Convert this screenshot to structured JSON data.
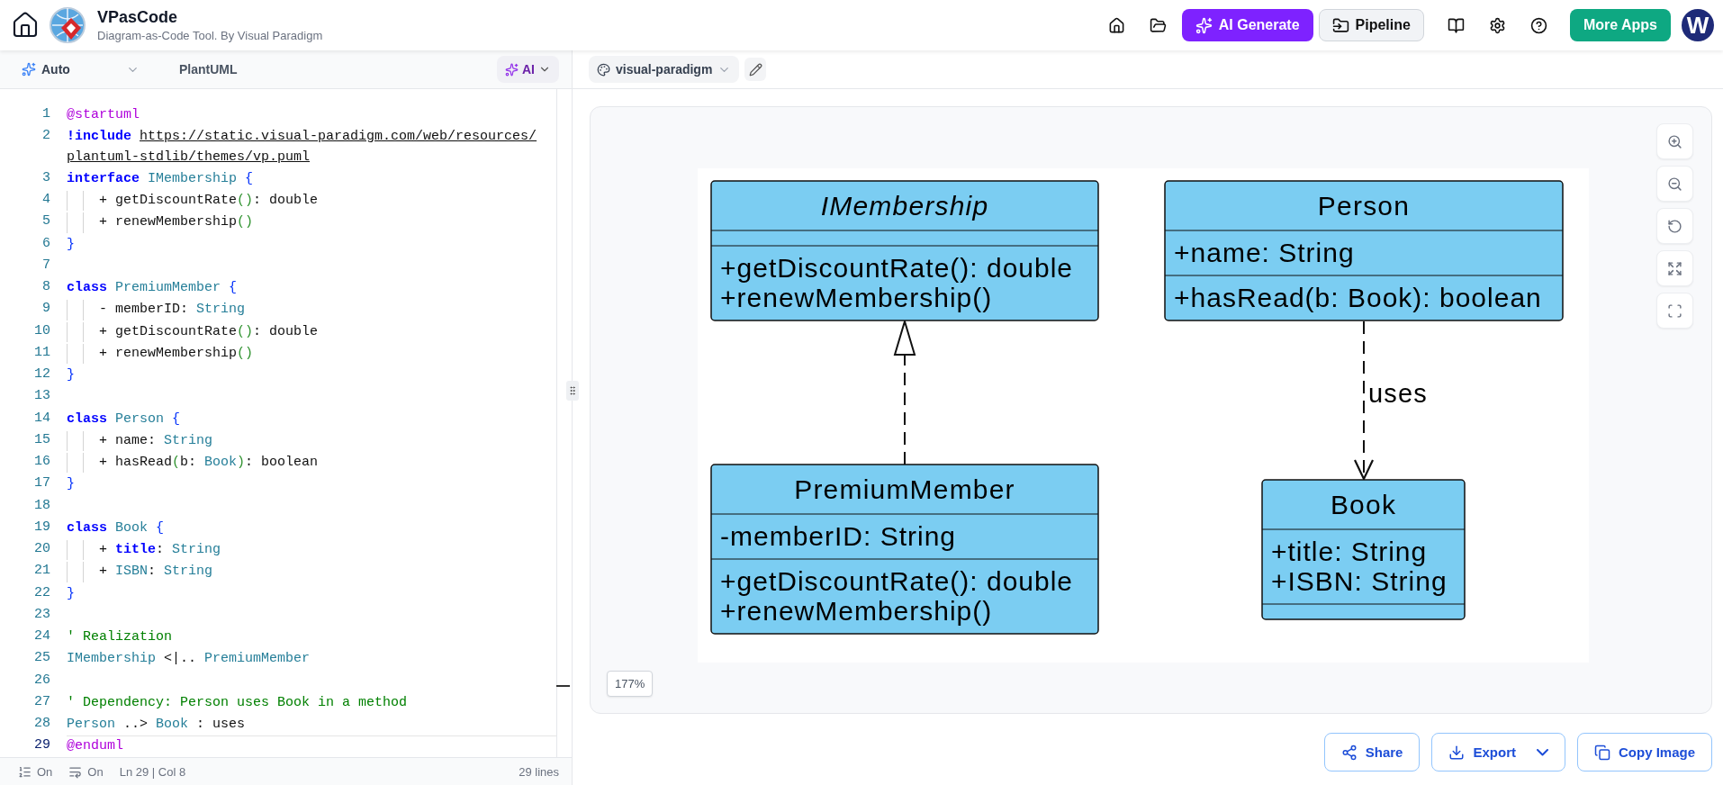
{
  "header": {
    "title": "VPasCode",
    "subtitle": "Diagram-as-Code Tool. By Visual Paradigm",
    "buttons": [
      {
        "kind": "ai",
        "label": "AI Generate"
      },
      {
        "kind": "pipeline",
        "label": "Pipeline"
      },
      {
        "kind": "apps",
        "label": "More Apps"
      }
    ],
    "avatar": "W"
  },
  "editor_toolbar": {
    "mode": "Auto",
    "language": "PlantUML",
    "ai": "AI"
  },
  "editor": {
    "lines": [
      {
        "n": "1",
        "indented": false,
        "current": false,
        "tokens": [
          {
            "kind": "directive",
            "text": "@startuml"
          }
        ]
      },
      {
        "n": "2",
        "indented": false,
        "current": false,
        "tokens": [
          {
            "kind": "keyword",
            "text": "!include "
          },
          {
            "kind": "link",
            "text": "https://static.visual-paradigm.com/web/resources/"
          },
          {
            "kind": "link",
            "text": "plantuml-stdlib/themes/vp.puml"
          }
        ]
      },
      {
        "n": "3",
        "indented": false,
        "current": false,
        "tokens": [
          {
            "kind": "keyword",
            "text": "interface "
          },
          {
            "kind": "type",
            "text": "IMembership "
          },
          {
            "kind": "brace",
            "text": "{"
          }
        ]
      },
      {
        "n": "4",
        "indented": true,
        "current": false,
        "tokens": [
          {
            "kind": "plain",
            "text": "+ getDiscountRate"
          },
          {
            "kind": "paren",
            "text": "()"
          },
          {
            "kind": "plain",
            "text": ": double"
          }
        ]
      },
      {
        "n": "5",
        "indented": true,
        "current": false,
        "tokens": [
          {
            "kind": "plain",
            "text": "+ renewMembership"
          },
          {
            "kind": "paren",
            "text": "()"
          }
        ]
      },
      {
        "n": "6",
        "indented": false,
        "current": false,
        "tokens": [
          {
            "kind": "brace",
            "text": "}"
          }
        ]
      },
      {
        "n": "7",
        "current": false
      },
      {
        "n": "8",
        "indented": false,
        "current": false,
        "tokens": [
          {
            "kind": "keyword",
            "text": "class "
          },
          {
            "kind": "type",
            "text": "PremiumMember "
          },
          {
            "kind": "brace",
            "text": "{"
          }
        ]
      },
      {
        "n": "9",
        "indented": true,
        "current": false,
        "tokens": [
          {
            "kind": "plain",
            "text": "- memberID: "
          },
          {
            "kind": "type",
            "text": "String"
          }
        ]
      },
      {
        "n": "10",
        "indented": true,
        "current": false,
        "tokens": [
          {
            "kind": "plain",
            "text": "+ getDiscountRate"
          },
          {
            "kind": "paren",
            "text": "()"
          },
          {
            "kind": "plain",
            "text": ": double"
          }
        ]
      },
      {
        "n": "11",
        "indented": true,
        "current": false,
        "tokens": [
          {
            "kind": "plain",
            "text": "+ renewMembership"
          },
          {
            "kind": "paren",
            "text": "()"
          }
        ]
      },
      {
        "n": "12",
        "indented": false,
        "current": false,
        "tokens": [
          {
            "kind": "brace",
            "text": "}"
          }
        ]
      },
      {
        "n": "13",
        "current": false
      },
      {
        "n": "14",
        "indented": false,
        "current": false,
        "tokens": [
          {
            "kind": "keyword",
            "text": "class "
          },
          {
            "kind": "type",
            "text": "Person "
          },
          {
            "kind": "brace",
            "text": "{"
          }
        ]
      },
      {
        "n": "15",
        "indented": true,
        "current": false,
        "tokens": [
          {
            "kind": "plain",
            "text": "+ name: "
          },
          {
            "kind": "type",
            "text": "String"
          }
        ]
      },
      {
        "n": "16",
        "indented": true,
        "current": false,
        "tokens": [
          {
            "kind": "plain",
            "text": "+ hasRead"
          },
          {
            "kind": "paren",
            "text": "("
          },
          {
            "kind": "plain",
            "text": "b: "
          },
          {
            "kind": "type",
            "text": "Book"
          },
          {
            "kind": "paren",
            "text": ")"
          },
          {
            "kind": "plain",
            "text": ": boolean"
          }
        ]
      },
      {
        "n": "17",
        "indented": false,
        "current": false,
        "tokens": [
          {
            "kind": "brace",
            "text": "}"
          }
        ]
      },
      {
        "n": "18",
        "current": false
      },
      {
        "n": "19",
        "indented": false,
        "current": false,
        "tokens": [
          {
            "kind": "keyword",
            "text": "class "
          },
          {
            "kind": "type",
            "text": "Book "
          },
          {
            "kind": "brace",
            "text": "{"
          }
        ]
      },
      {
        "n": "20",
        "indented": true,
        "current": false,
        "tokens": [
          {
            "kind": "plain",
            "text": "+ "
          },
          {
            "kind": "keyword",
            "text": "title"
          },
          {
            "kind": "plain",
            "text": ": "
          },
          {
            "kind": "type",
            "text": "String"
          }
        ]
      },
      {
        "n": "21",
        "indented": true,
        "current": false,
        "tokens": [
          {
            "kind": "plain",
            "text": "+ "
          },
          {
            "kind": "type",
            "text": "ISBN"
          },
          {
            "kind": "plain",
            "text": ": "
          },
          {
            "kind": "type",
            "text": "String"
          }
        ]
      },
      {
        "n": "22",
        "indented": false,
        "current": false,
        "tokens": [
          {
            "kind": "brace",
            "text": "}"
          }
        ]
      },
      {
        "n": "23",
        "current": false
      },
      {
        "n": "24",
        "indented": false,
        "current": false,
        "tokens": [
          {
            "kind": "comment",
            "text": "' Realization"
          }
        ]
      },
      {
        "n": "25",
        "indented": false,
        "current": false,
        "tokens": [
          {
            "kind": "type",
            "text": "IMembership "
          },
          {
            "kind": "plain",
            "text": "<|.. "
          },
          {
            "kind": "type",
            "text": "PremiumMember"
          }
        ]
      },
      {
        "n": "26",
        "current": false
      },
      {
        "n": "27",
        "indented": false,
        "current": false,
        "tokens": [
          {
            "kind": "comment",
            "text": "' Dependency: Person uses Book in a method"
          }
        ]
      },
      {
        "n": "28",
        "indented": false,
        "current": false,
        "tokens": [
          {
            "kind": "type",
            "text": "Person "
          },
          {
            "kind": "plain",
            "text": "..> "
          },
          {
            "kind": "type",
            "text": "Book "
          },
          {
            "kind": "plain",
            "text": ": uses"
          }
        ]
      },
      {
        "n": "29",
        "indented": false,
        "current": true,
        "tokens": [
          {
            "kind": "directive",
            "text": "@enduml"
          }
        ]
      }
    ]
  },
  "status_bar": {
    "line_numbers": "On",
    "word_wrap": "On",
    "position": "Ln 29 | Col 8",
    "line_count": "29 lines"
  },
  "diagram_toolbar": {
    "theme": "visual-paradigm"
  },
  "diagram": {
    "classes": [
      {
        "kind": "interface",
        "name": "IMembership",
        "methods": [
          "+getDiscountRate(): double",
          "+renewMembership()"
        ]
      },
      {
        "kind": "class",
        "name": "Person",
        "attributes": [
          "+name: String"
        ],
        "methods": [
          "+hasRead(b: Book): boolean"
        ]
      },
      {
        "kind": "class",
        "name": "PremiumMember",
        "attributes": [
          "-memberID: String"
        ],
        "methods": [
          "+getDiscountRate(): double",
          "+renewMembership()"
        ]
      },
      {
        "kind": "class",
        "name": "Book",
        "attributes": [
          "+title: String",
          "+ISBN: String"
        ]
      }
    ],
    "relations": [
      {
        "kind": "realization"
      },
      {
        "kind": "dependency",
        "label": "uses"
      }
    ]
  },
  "canvas": {
    "zoom": "177%"
  },
  "actions": [
    {
      "kind": "share",
      "label": "Share"
    },
    {
      "kind": "export",
      "label": "Export"
    },
    {
      "kind": "copy",
      "label": "Copy Image"
    }
  ]
}
